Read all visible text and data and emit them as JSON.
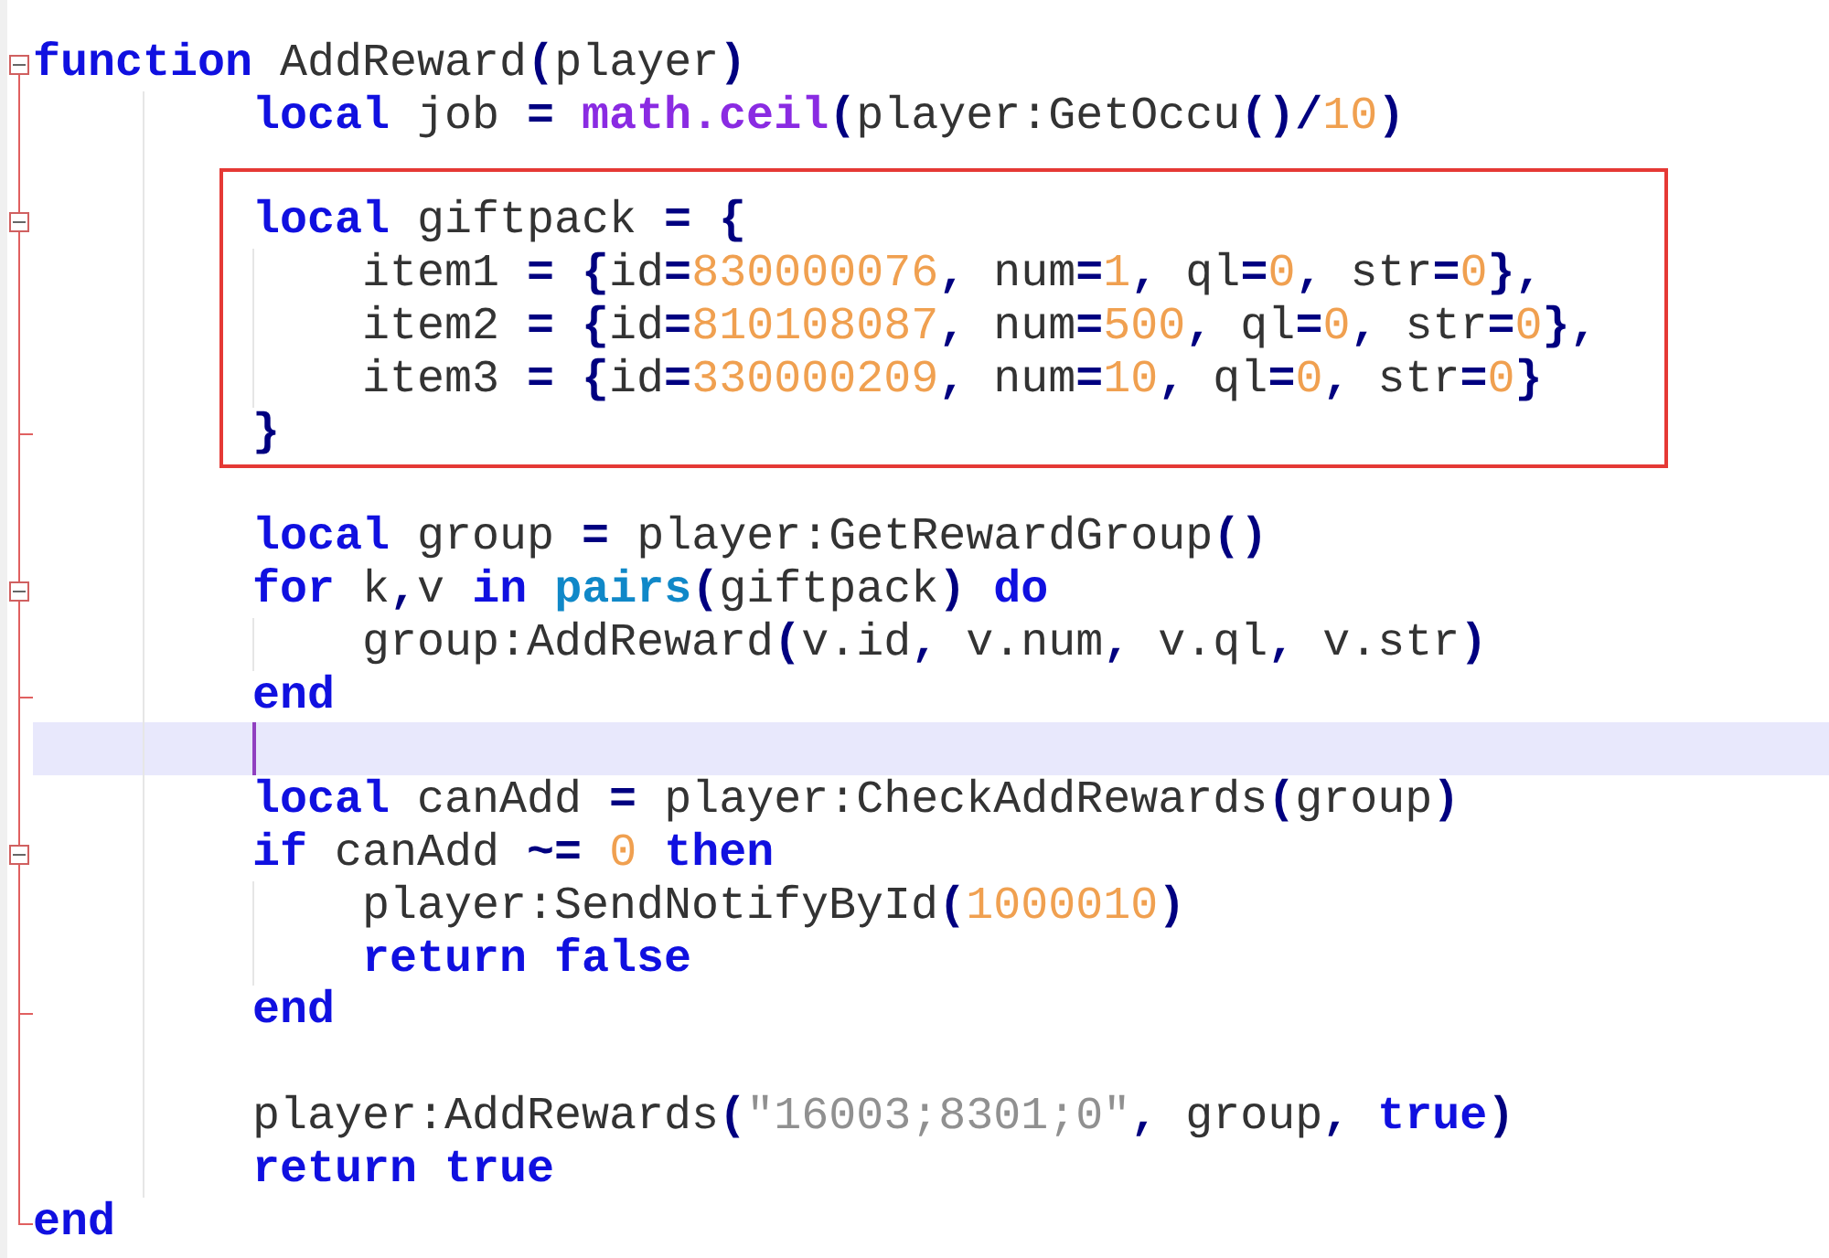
{
  "lines": [
    {
      "kind": "code",
      "expanded": true,
      "tokens": [
        {
          "kind": "keyword",
          "text": "function"
        },
        {
          "kind": "plain",
          "text": " AddReward"
        },
        {
          "kind": "op",
          "text": "("
        },
        {
          "kind": "plain",
          "text": "player"
        },
        {
          "kind": "op",
          "text": ")"
        }
      ],
      "children": [
        {
          "kind": "code",
          "tokens": [
            {
              "kind": "keyword",
              "text": "local"
            },
            {
              "kind": "plain",
              "text": " job "
            },
            {
              "kind": "op",
              "text": "= "
            },
            {
              "kind": "builtin",
              "text": "math.ceil"
            },
            {
              "kind": "op",
              "text": "("
            },
            {
              "kind": "plain",
              "text": "player:GetOccu"
            },
            {
              "kind": "op",
              "text": "()/"
            },
            {
              "kind": "number",
              "text": "10"
            },
            {
              "kind": "op",
              "text": ")"
            }
          ]
        },
        {
          "kind": "blank"
        },
        {
          "kind": "code",
          "expanded": true,
          "boxed": true,
          "tokens": [
            {
              "kind": "keyword",
              "text": "local"
            },
            {
              "kind": "plain",
              "text": " giftpack "
            },
            {
              "kind": "op",
              "text": "= {"
            }
          ],
          "children": [
            {
              "kind": "code",
              "tokens": [
                {
                  "kind": "plain",
                  "text": "item1 "
                },
                {
                  "kind": "op",
                  "text": "= {"
                },
                {
                  "kind": "plain",
                  "text": "id"
                },
                {
                  "kind": "op",
                  "text": "="
                },
                {
                  "kind": "number",
                  "text": "830000076"
                },
                {
                  "kind": "op",
                  "text": ","
                },
                {
                  "kind": "plain",
                  "text": " num"
                },
                {
                  "kind": "op",
                  "text": "="
                },
                {
                  "kind": "number",
                  "text": "1"
                },
                {
                  "kind": "op",
                  "text": ","
                },
                {
                  "kind": "plain",
                  "text": " ql"
                },
                {
                  "kind": "op",
                  "text": "="
                },
                {
                  "kind": "number",
                  "text": "0"
                },
                {
                  "kind": "op",
                  "text": ","
                },
                {
                  "kind": "plain",
                  "text": " str"
                },
                {
                  "kind": "op",
                  "text": "="
                },
                {
                  "kind": "number",
                  "text": "0"
                },
                {
                  "kind": "op",
                  "text": "},"
                }
              ]
            },
            {
              "kind": "code",
              "tokens": [
                {
                  "kind": "plain",
                  "text": "item2 "
                },
                {
                  "kind": "op",
                  "text": "= {"
                },
                {
                  "kind": "plain",
                  "text": "id"
                },
                {
                  "kind": "op",
                  "text": "="
                },
                {
                  "kind": "number",
                  "text": "810108087"
                },
                {
                  "kind": "op",
                  "text": ","
                },
                {
                  "kind": "plain",
                  "text": " num"
                },
                {
                  "kind": "op",
                  "text": "="
                },
                {
                  "kind": "number",
                  "text": "500"
                },
                {
                  "kind": "op",
                  "text": ","
                },
                {
                  "kind": "plain",
                  "text": " ql"
                },
                {
                  "kind": "op",
                  "text": "="
                },
                {
                  "kind": "number",
                  "text": "0"
                },
                {
                  "kind": "op",
                  "text": ","
                },
                {
                  "kind": "plain",
                  "text": " str"
                },
                {
                  "kind": "op",
                  "text": "="
                },
                {
                  "kind": "number",
                  "text": "0"
                },
                {
                  "kind": "op",
                  "text": "},"
                }
              ]
            },
            {
              "kind": "code",
              "tokens": [
                {
                  "kind": "plain",
                  "text": "item3 "
                },
                {
                  "kind": "op",
                  "text": "= {"
                },
                {
                  "kind": "plain",
                  "text": "id"
                },
                {
                  "kind": "op",
                  "text": "="
                },
                {
                  "kind": "number",
                  "text": "330000209"
                },
                {
                  "kind": "op",
                  "text": ","
                },
                {
                  "kind": "plain",
                  "text": " num"
                },
                {
                  "kind": "op",
                  "text": "="
                },
                {
                  "kind": "number",
                  "text": "10"
                },
                {
                  "kind": "op",
                  "text": ","
                },
                {
                  "kind": "plain",
                  "text": " ql"
                },
                {
                  "kind": "op",
                  "text": "="
                },
                {
                  "kind": "number",
                  "text": "0"
                },
                {
                  "kind": "op",
                  "text": ","
                },
                {
                  "kind": "plain",
                  "text": " str"
                },
                {
                  "kind": "op",
                  "text": "="
                },
                {
                  "kind": "number",
                  "text": "0"
                },
                {
                  "kind": "op",
                  "text": "}"
                }
              ]
            }
          ]
        },
        {
          "kind": "code",
          "fold_end": true,
          "tokens": [
            {
              "kind": "op",
              "text": "}"
            }
          ]
        },
        {
          "kind": "blank"
        },
        {
          "kind": "code",
          "tokens": [
            {
              "kind": "keyword",
              "text": "local"
            },
            {
              "kind": "plain",
              "text": " group "
            },
            {
              "kind": "op",
              "text": "="
            },
            {
              "kind": "plain",
              "text": " player:GetRewardGroup"
            },
            {
              "kind": "op",
              "text": "()"
            }
          ]
        },
        {
          "kind": "code",
          "expanded": true,
          "tokens": [
            {
              "kind": "keyword",
              "text": "for"
            },
            {
              "kind": "plain",
              "text": " k"
            },
            {
              "kind": "op",
              "text": ","
            },
            {
              "kind": "plain",
              "text": "v "
            },
            {
              "kind": "keyword",
              "text": "in "
            },
            {
              "kind": "func",
              "text": "pairs"
            },
            {
              "kind": "op",
              "text": "("
            },
            {
              "kind": "plain",
              "text": "giftpack"
            },
            {
              "kind": "op",
              "text": ") "
            },
            {
              "kind": "keyword",
              "text": "do"
            }
          ],
          "children": [
            {
              "kind": "code",
              "tokens": [
                {
                  "kind": "plain",
                  "text": "group:AddReward"
                },
                {
                  "kind": "op",
                  "text": "("
                },
                {
                  "kind": "plain",
                  "text": "v.id"
                },
                {
                  "kind": "op",
                  "text": ","
                },
                {
                  "kind": "plain",
                  "text": " v.num"
                },
                {
                  "kind": "op",
                  "text": ","
                },
                {
                  "kind": "plain",
                  "text": " v.ql"
                },
                {
                  "kind": "op",
                  "text": ","
                },
                {
                  "kind": "plain",
                  "text": " v.str"
                },
                {
                  "kind": "op",
                  "text": ")"
                }
              ]
            }
          ]
        },
        {
          "kind": "code",
          "fold_end": true,
          "tokens": [
            {
              "kind": "keyword",
              "text": "end"
            }
          ]
        },
        {
          "kind": "blank",
          "current": true
        },
        {
          "kind": "code",
          "tokens": [
            {
              "kind": "keyword",
              "text": "local"
            },
            {
              "kind": "plain",
              "text": " canAdd "
            },
            {
              "kind": "op",
              "text": "="
            },
            {
              "kind": "plain",
              "text": " player:CheckAddRewards"
            },
            {
              "kind": "op",
              "text": "("
            },
            {
              "kind": "plain",
              "text": "group"
            },
            {
              "kind": "op",
              "text": ")"
            }
          ]
        },
        {
          "kind": "code",
          "expanded": true,
          "tokens": [
            {
              "kind": "keyword",
              "text": "if"
            },
            {
              "kind": "plain",
              "text": " canAdd "
            },
            {
              "kind": "op",
              "text": "~= "
            },
            {
              "kind": "number",
              "text": "0"
            },
            {
              "kind": "keyword",
              "text": " then"
            }
          ],
          "children": [
            {
              "kind": "code",
              "tokens": [
                {
                  "kind": "plain",
                  "text": "player:SendNotifyById"
                },
                {
                  "kind": "op",
                  "text": "("
                },
                {
                  "kind": "number",
                  "text": "1000010"
                },
                {
                  "kind": "op",
                  "text": ")"
                }
              ]
            },
            {
              "kind": "code",
              "tokens": [
                {
                  "kind": "keyword",
                  "text": "return false"
                }
              ]
            }
          ]
        },
        {
          "kind": "code",
          "fold_end": true,
          "tokens": [
            {
              "kind": "keyword",
              "text": "end"
            }
          ]
        },
        {
          "kind": "blank"
        },
        {
          "kind": "code",
          "tokens": [
            {
              "kind": "plain",
              "text": "player:AddRewards"
            },
            {
              "kind": "op",
              "text": "("
            },
            {
              "kind": "string",
              "text": "\"16003;8301;0\""
            },
            {
              "kind": "op",
              "text": ","
            },
            {
              "kind": "plain",
              "text": " group"
            },
            {
              "kind": "op",
              "text": ", "
            },
            {
              "kind": "keyword",
              "text": "true"
            },
            {
              "kind": "op",
              "text": ")"
            }
          ]
        },
        {
          "kind": "code",
          "tokens": [
            {
              "kind": "keyword",
              "text": "return true"
            }
          ]
        }
      ]
    },
    {
      "kind": "code",
      "fold_end": true,
      "tokens": [
        {
          "kind": "keyword",
          "text": "end"
        }
      ]
    }
  ]
}
